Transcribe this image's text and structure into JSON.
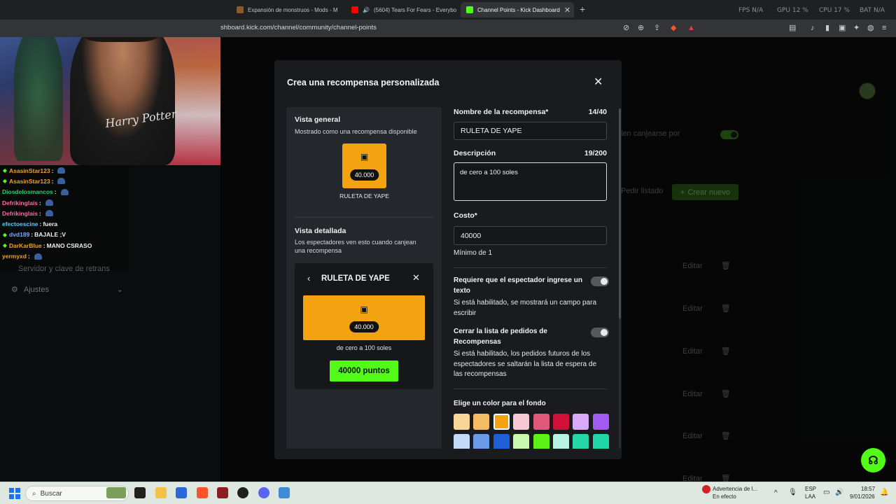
{
  "browser": {
    "tabs": [
      {
        "title": "Expansión de monstruos - Mods - M",
        "active": false,
        "color": "#8a5a2b"
      },
      {
        "title": "(5604) Tears For Fears - Everybod",
        "active": false,
        "color": "#ff0000"
      },
      {
        "title": "Channel Points - Kick Dashboard",
        "active": true,
        "color": "#53fc18"
      }
    ],
    "new_tab": "+",
    "stats": {
      "fps": "FPS N/A",
      "gpu": "GPU 12 %",
      "cpu": "CPU 17 %",
      "bat": "BAT N/A"
    },
    "url": "shboard.kick.com/channel/community/channel-points"
  },
  "background": {
    "setting_text": "len canjearse por",
    "pedir_listado": "Pedir listado",
    "crear_nuevo": "Crear nuevo",
    "edit_label": "Editar",
    "sidebar_servidor": "Servidor y clave de retrans",
    "sidebar_ajustes": "Ajustes",
    "accent": "#53fc18"
  },
  "chat": [
    {
      "user": "AsasinStar123",
      "msg": "",
      "color": "#f0a02c",
      "badge": true
    },
    {
      "user": "AsasinStar123",
      "msg": "",
      "color": "#f0a02c",
      "badge": true
    },
    {
      "user": "Diosdelosmancos",
      "msg": "",
      "color": "#2ecc71",
      "badge": false
    },
    {
      "user": "Defrikinglais",
      "msg": "",
      "color": "#ff6b9a",
      "badge": false
    },
    {
      "user": "Defrikinglais",
      "msg": "",
      "color": "#ff6b9a",
      "badge": false
    },
    {
      "user": "efectoescine",
      "msg": "fuera",
      "color": "#5cc8ff",
      "badge": false
    },
    {
      "user": "dvd189",
      "msg": "BAJALE ;V",
      "color": "#7aa7ff",
      "badge": true
    },
    {
      "user": "DarKarBlue",
      "msg": "MANO CSRASO",
      "color": "#f0a02c",
      "badge": true
    },
    {
      "user": "yermyxd",
      "msg": "",
      "color": "#f0a02c",
      "badge": false
    }
  ],
  "webcam": {
    "shirt_text": "Harry Potter"
  },
  "modal": {
    "title": "Crea una recompensa personalizada",
    "overview": {
      "heading": "Vista general",
      "sub": "Mostrado como una recompensa disponible",
      "cost_pill": "40.000",
      "name": "RULETA DE YAPE"
    },
    "detail": {
      "heading": "Vista detallada",
      "sub": "Los espectadores ven esto cuando canjean una recompensa",
      "title": "RULETA DE YAPE",
      "cost_pill": "40.000",
      "description": "de cero a 100 soles",
      "button": "40000 puntos"
    },
    "form": {
      "name_label": "Nombre de la recompensa*",
      "name_count": "14/40",
      "name_value": "RULETA DE YAPE",
      "desc_label": "Descripción",
      "desc_count": "19/200",
      "desc_value": "de cero a 100 soles",
      "cost_label": "Costo*",
      "cost_value": "40000",
      "cost_hint": "Mínimo de 1",
      "require_text_label": "Requiere que el espectador ingrese un texto",
      "require_text_hint": "Si está habilitado, se mostrará un campo para escribir",
      "close_queue_label": "Cerrar la lista de pedidos de Recompensas",
      "close_queue_hint": "Si está habilitado, los pedidos futuros de los espectadores se saltarán la lista de espera de las recompensas",
      "color_label": "Elige un color para el fondo",
      "swatches": [
        "#f9d59a",
        "#f2bb64",
        "#f2a30f",
        "#f6c9d4",
        "#e0587c",
        "#d1113a",
        "#d7a9f7",
        "#a35af2",
        "#c4d9f7",
        "#6a9be8",
        "#1f5fd6",
        "#c9f7b0",
        "#5cf218",
        "#b8f2e0",
        "#27d6a8",
        "#1fd6a8"
      ],
      "selected_swatch": "#f2a30f"
    }
  },
  "taskbar": {
    "search": "Buscar",
    "notification_title": "Advertencia de l...",
    "notification_sub": "En efecto",
    "lang1": "ESP",
    "lang2": "LAA",
    "time": "18:57",
    "date": "9/01/2026"
  }
}
